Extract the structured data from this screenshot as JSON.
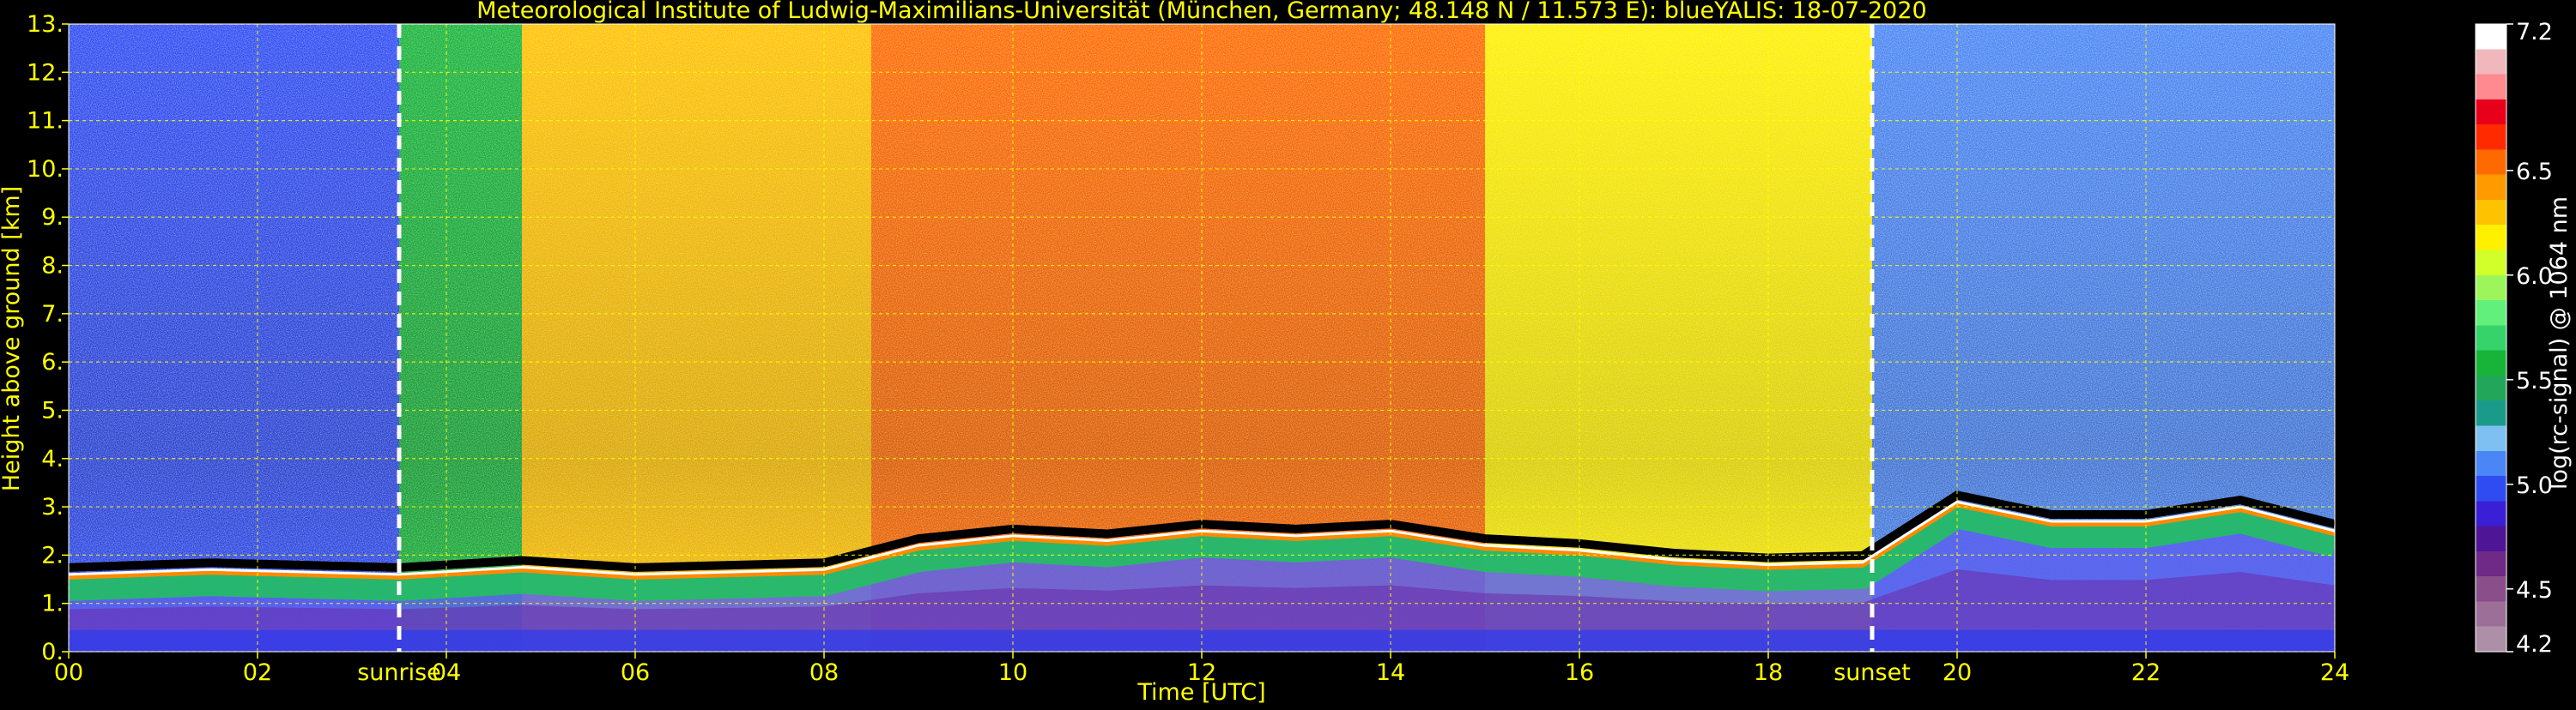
{
  "chart_data": {
    "type": "heatmap",
    "title": "Meteorological Institute of Ludwig-Maximilians-Universität (München, Germany; 48.148 N / 11.573 E):    blueYALIS: 18-07-2020",
    "xlabel": "Time [UTC]",
    "ylabel": "Height above ground [km]",
    "xlim": [
      0,
      24
    ],
    "ylim": [
      0,
      13
    ],
    "xticks": [
      0,
      2,
      4,
      6,
      8,
      10,
      12,
      14,
      16,
      18,
      20,
      22,
      24
    ],
    "xtick_labels": [
      "00",
      "02",
      "04",
      "06",
      "08",
      "10",
      "12",
      "14",
      "16",
      "18",
      "20",
      "22",
      "24"
    ],
    "yticks": [
      0,
      1,
      2,
      3,
      4,
      5,
      6,
      7,
      8,
      9,
      10,
      11,
      12,
      13
    ],
    "ytick_labels": [
      "0.",
      "1.",
      "2.",
      "3.",
      "4.",
      "5.",
      "6.",
      "7.",
      "8.",
      "9.",
      "10.",
      "11.",
      "12.",
      "13."
    ],
    "grid": true,
    "grid_color": "#ffff00",
    "colorbar": {
      "label": "log(rc-signal) @ 1064 nm",
      "vmin": 4.2,
      "vmax": 7.2,
      "ticks": [
        4.2,
        4.5,
        5.0,
        5.5,
        6.0,
        6.5,
        7.2
      ],
      "tick_labels": [
        "4.2",
        "4.5",
        "5.0",
        "5.5",
        "6.0",
        "6.5",
        "7.2"
      ],
      "colors": [
        "#ad8fa8",
        "#9c6f98",
        "#8a4f8a",
        "#6e2a86",
        "#4e1596",
        "#3b1fd6",
        "#2f4cf3",
        "#4a86f5",
        "#7fc0f2",
        "#1a9b8a",
        "#22a65a",
        "#18b43a",
        "#35d36a",
        "#62f07c",
        "#9cf55a",
        "#d2ff2a",
        "#fff000",
        "#ffc200",
        "#ff9a00",
        "#ff6a00",
        "#ff2a00",
        "#e8001a",
        "#ff8a90",
        "#f0b8bc",
        "#ffffff"
      ]
    },
    "annotations": [
      {
        "text": "sunrise",
        "x": 3.5
      },
      {
        "text": "sunset",
        "x": 19.1
      }
    ],
    "vlines": [
      3.5,
      19.1
    ],
    "boundary_layer_top": [
      {
        "x": 0.0,
        "y": 1.6
      },
      {
        "x": 1.5,
        "y": 1.7
      },
      {
        "x": 3.5,
        "y": 1.6
      },
      {
        "x": 4.8,
        "y": 1.75
      },
      {
        "x": 6.0,
        "y": 1.6
      },
      {
        "x": 8.0,
        "y": 1.7
      },
      {
        "x": 9.0,
        "y": 2.2
      },
      {
        "x": 10.0,
        "y": 2.4
      },
      {
        "x": 11.0,
        "y": 2.3
      },
      {
        "x": 12.0,
        "y": 2.5
      },
      {
        "x": 13.0,
        "y": 2.4
      },
      {
        "x": 14.0,
        "y": 2.5
      },
      {
        "x": 15.0,
        "y": 2.2
      },
      {
        "x": 16.0,
        "y": 2.1
      },
      {
        "x": 17.0,
        "y": 1.9
      },
      {
        "x": 18.0,
        "y": 1.8
      },
      {
        "x": 19.0,
        "y": 1.85
      },
      {
        "x": 20.0,
        "y": 3.1
      },
      {
        "x": 21.0,
        "y": 2.7
      },
      {
        "x": 22.0,
        "y": 2.7
      },
      {
        "x": 23.0,
        "y": 3.0
      },
      {
        "x": 24.0,
        "y": 2.5
      }
    ],
    "color_zones": [
      {
        "x0": 0.0,
        "x1": 3.5,
        "level": 5.0
      },
      {
        "x0": 3.5,
        "x1": 4.8,
        "level": 5.6
      },
      {
        "x0": 4.8,
        "x1": 8.5,
        "level": 6.3
      },
      {
        "x0": 8.5,
        "x1": 15.0,
        "level": 6.5
      },
      {
        "x0": 15.0,
        "x1": 19.1,
        "level": 6.2
      },
      {
        "x0": 19.1,
        "x1": 24.0,
        "level": 5.1
      }
    ]
  }
}
